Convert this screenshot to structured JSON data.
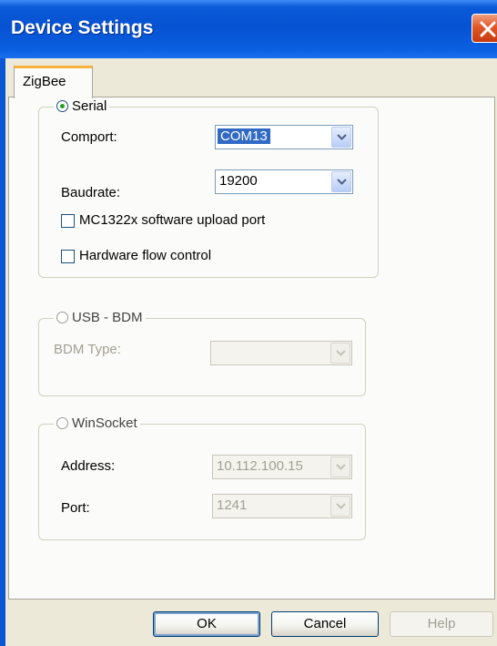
{
  "window": {
    "title": "Device Settings"
  },
  "tabs": [
    {
      "label": "ZigBee",
      "active": true
    }
  ],
  "serial": {
    "legend": "Serial",
    "selected": true,
    "comport_label": "Comport:",
    "comport_value": "COM13",
    "baudrate_label": "Baudrate:",
    "baudrate_value": "19200",
    "upload_port_label": "MC1322x software upload port",
    "upload_port_checked": false,
    "flow_control_label": "Hardware flow control",
    "flow_control_checked": false
  },
  "usb_bdm": {
    "legend": "USB - BDM",
    "selected": false,
    "bdm_type_label": "BDM Type:",
    "bdm_type_value": ""
  },
  "winsocket": {
    "legend": "WinSocket",
    "selected": false,
    "address_label": "Address:",
    "address_value": "10.112.100.15",
    "port_label": "Port:",
    "port_value": "1241"
  },
  "buttons": {
    "ok": "OK",
    "cancel": "Cancel",
    "help": "Help"
  },
  "colors": {
    "titlebar": "#0652d2",
    "close": "#e05828",
    "dialog_bg": "#ece9d8",
    "selection": "#316ac5"
  }
}
